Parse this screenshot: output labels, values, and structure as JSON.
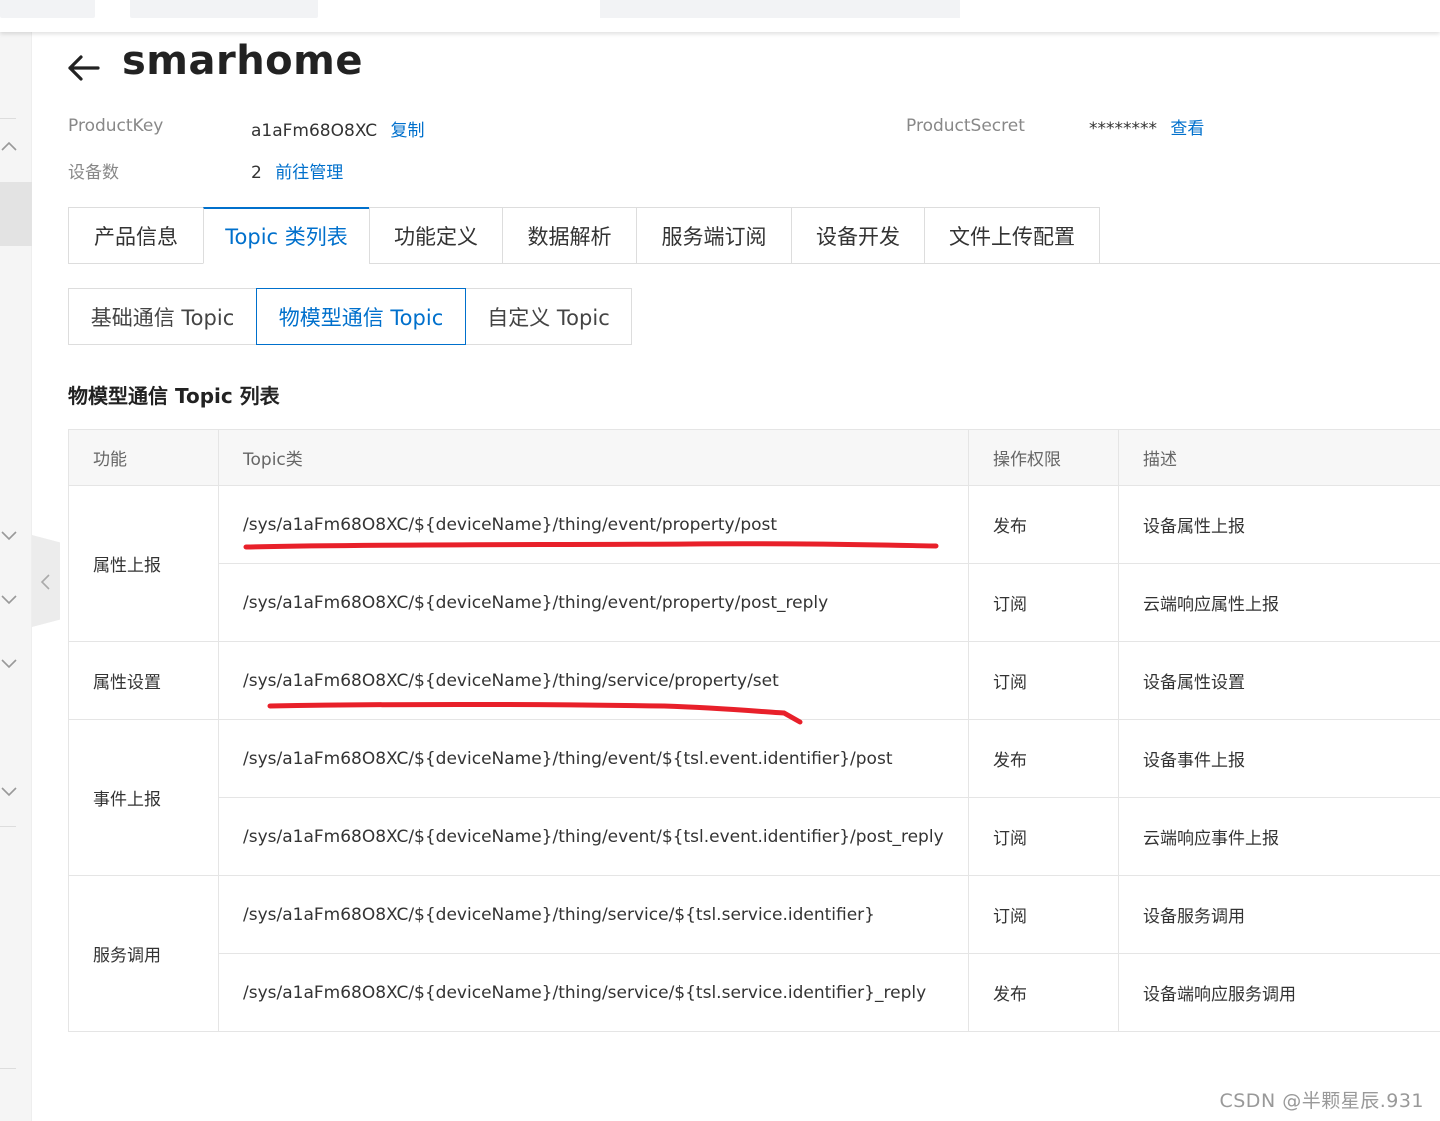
{
  "page": {
    "title": "smarhome",
    "product_key_label": "ProductKey",
    "product_key_value": "a1aFm68O8XC",
    "copy_link": "复制",
    "product_secret_label": "ProductSecret",
    "product_secret_value": "********",
    "view_link": "查看",
    "device_count_label": "设备数",
    "device_count_value": "2",
    "manage_link": "前往管理"
  },
  "tabs": [
    {
      "label": "产品信息",
      "active": false
    },
    {
      "label": "Topic 类列表",
      "active": true
    },
    {
      "label": "功能定义",
      "active": false
    },
    {
      "label": "数据解析",
      "active": false
    },
    {
      "label": "服务端订阅",
      "active": false
    },
    {
      "label": "设备开发",
      "active": false
    },
    {
      "label": "文件上传配置",
      "active": false
    }
  ],
  "subtabs": [
    {
      "label": "基础通信 Topic",
      "active": false
    },
    {
      "label": "物模型通信 Topic",
      "active": true
    },
    {
      "label": "自定义 Topic",
      "active": false
    }
  ],
  "section_title": "物模型通信 Topic 列表",
  "table": {
    "headers": [
      "功能",
      "Topic类",
      "操作权限",
      "描述"
    ],
    "groups": [
      {
        "func": "属性上报",
        "rows": [
          {
            "topic": "/sys/a1aFm68O8XC/${deviceName}/thing/event/property/post",
            "perm": "发布",
            "desc": "设备属性上报"
          },
          {
            "topic": "/sys/a1aFm68O8XC/${deviceName}/thing/event/property/post_reply",
            "perm": "订阅",
            "desc": "云端响应属性上报"
          }
        ]
      },
      {
        "func": "属性设置",
        "rows": [
          {
            "topic": "/sys/a1aFm68O8XC/${deviceName}/thing/service/property/set",
            "perm": "订阅",
            "desc": "设备属性设置"
          }
        ]
      },
      {
        "func": "事件上报",
        "rows": [
          {
            "topic": "/sys/a1aFm68O8XC/${deviceName}/thing/event/${tsl.event.identifier}/post",
            "perm": "发布",
            "desc": "设备事件上报"
          },
          {
            "topic": "/sys/a1aFm68O8XC/${deviceName}/thing/event/${tsl.event.identifier}/post_reply",
            "perm": "订阅",
            "desc": "云端响应事件上报"
          }
        ]
      },
      {
        "func": "服务调用",
        "rows": [
          {
            "topic": "/sys/a1aFm68O8XC/${deviceName}/thing/service/${tsl.service.identifier}",
            "perm": "订阅",
            "desc": "设备服务调用"
          },
          {
            "topic": "/sys/a1aFm68O8XC/${deviceName}/thing/service/${tsl.service.identifier}_reply",
            "perm": "发布",
            "desc": "设备端响应服务调用"
          }
        ]
      }
    ]
  },
  "watermark": "CSDN @半颗星辰.931",
  "colors": {
    "accent": "#0070cc",
    "annotation": "#e8202a"
  },
  "icons": {
    "back": "arrow-left-icon",
    "collapse": "chevron-left-icon",
    "rail": "chevron-down-icon"
  }
}
